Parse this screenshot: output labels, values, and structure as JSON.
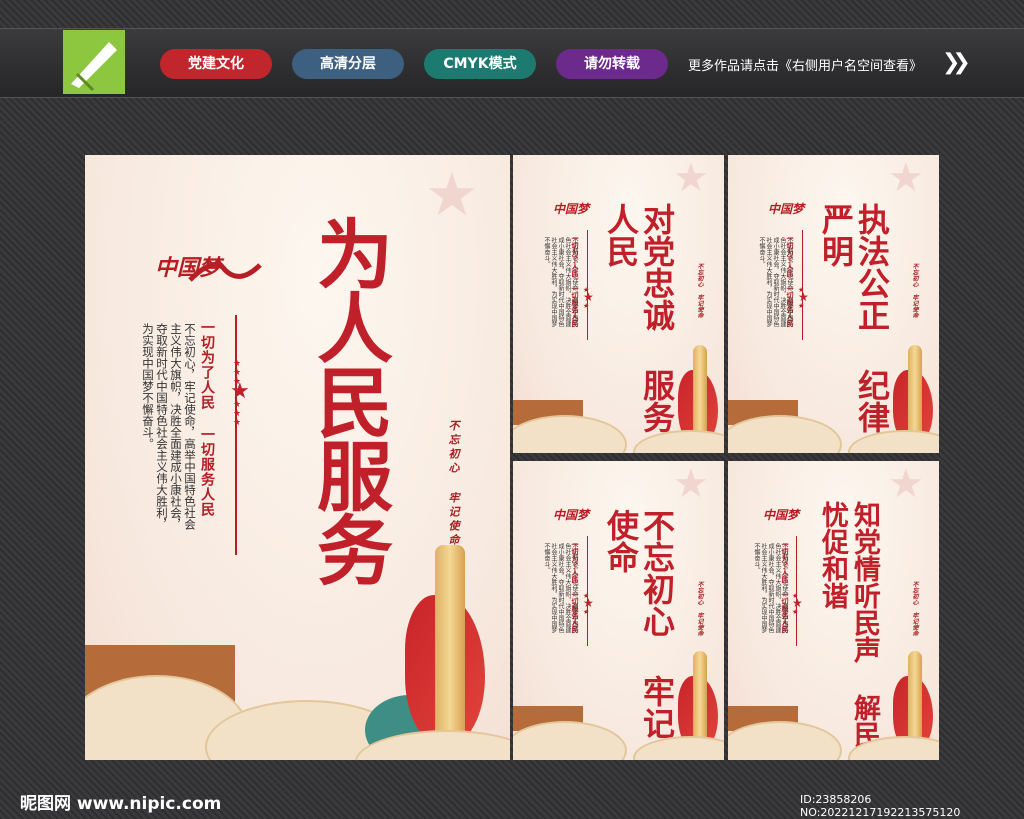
{
  "header": {
    "tags": [
      {
        "label": "党建文化",
        "color": "#c0262b"
      },
      {
        "label": "高清分层",
        "color": "#3d5f80"
      },
      {
        "label": "CMYK模式",
        "color": "#1d7a70"
      },
      {
        "label": "请勿转载",
        "color": "#6b2a8c"
      }
    ],
    "more_text": "更多作品请点击《右侧用户名空间查看》",
    "arrow_icon": "double-chevron-right-icon"
  },
  "main_poster": {
    "title": "为人民服务",
    "slogan": "一切为了人民 一切服务人民",
    "body_lines": [
      "不忘初心，牢记使命，高举中国特色",
      "社会主义伟大旗帜，决胜全面建成小康",
      "社会，夺取新时代中国特色社会主义伟大",
      "胜利，为实现中国梦不懈奋斗。"
    ],
    "sub": "不忘初心 牢记使命",
    "dream": "中国梦"
  },
  "small_posters": [
    {
      "title_lines": [
        "对党忠诚",
        "服务人民"
      ]
    },
    {
      "title_lines": [
        "执法公正",
        "纪律严明"
      ]
    },
    {
      "title_lines": [
        "不忘初心",
        "牢记使命"
      ]
    },
    {
      "title_lines": [
        "知党情听民声",
        "解民忧促和谐"
      ]
    }
  ],
  "small_common": {
    "slogan": "一切为了人民 一切服务人民",
    "body_lines": [
      "不忘初心，牢记使命，高举中国特色",
      "社会主义伟大旗帜，决胜全面建成小康",
      "社会，夺取新时代中国特色社会主义伟大",
      "胜利，为实现中国梦不懈奋斗。"
    ],
    "sub": "不忘初心 牢记使命",
    "dream": "中国梦"
  },
  "footer": {
    "site": "昵图网 www.nipic.com",
    "id": "ID:23858206 NO:20221217192213575120"
  }
}
